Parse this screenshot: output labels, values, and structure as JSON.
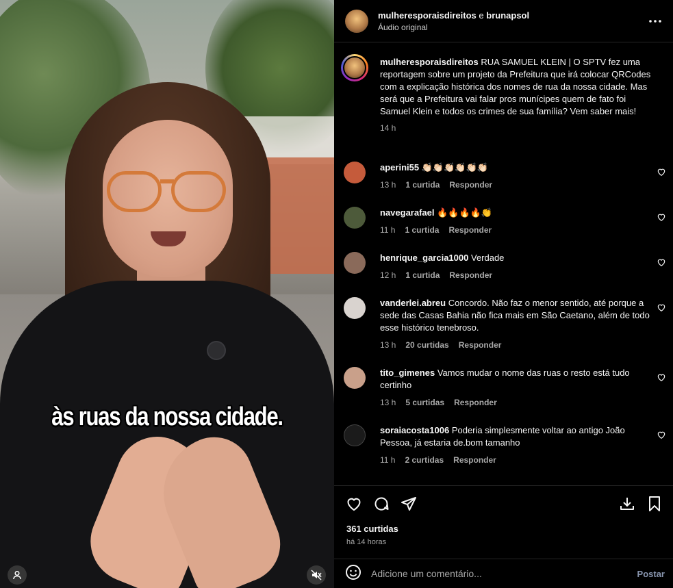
{
  "video": {
    "subtitle": "às ruas da nossa cidade."
  },
  "header": {
    "author1": "mulheresporaisdireitos",
    "conjunction": "e",
    "author2": "brunapsol",
    "audio": "Áudio original"
  },
  "post_caption": {
    "username": "mulheresporaisdireitos",
    "text": "RUA SAMUEL KLEIN | O SPTV fez uma reportagem sobre um projeto da Prefeitura que irá colocar QRCodes com a explicação histórica dos nomes de rua da nossa cidade. Mas será que a Prefeitura vai falar pros munícipes quem de fato foi Samuel Klein e todos os crimes de sua família? Vem saber mais!",
    "time": "14 h"
  },
  "comments": [
    {
      "username": "aperini55",
      "text": "👏🏻👏🏻👏🏻👏🏻👏🏻👏🏻",
      "time": "13 h",
      "likes": "1 curtida",
      "reply": "Responder",
      "avatar_color": "#c55b3b"
    },
    {
      "username": "navegarafael",
      "text": "🔥🔥🔥🔥👏",
      "time": "11 h",
      "likes": "1 curtida",
      "reply": "Responder",
      "avatar_color": "#4d5a3a"
    },
    {
      "username": "henrique_garcia1000",
      "text": "Verdade",
      "time": "12 h",
      "likes": "1 curtida",
      "reply": "Responder",
      "avatar_color": "#8a6a5a"
    },
    {
      "username": "vanderlei.abreu",
      "text": "Concordo. Não faz o menor sentido, até porque a sede das Casas Bahia não fica mais em São Caetano, além de todo esse histórico tenebroso.",
      "time": "13 h",
      "likes": "20 curtidas",
      "reply": "Responder",
      "avatar_color": "#d9d3cf"
    },
    {
      "username": "tito_gimenes",
      "text": "Vamos mudar o nome das ruas o resto está tudo certinho",
      "time": "13 h",
      "likes": "5 curtidas",
      "reply": "Responder",
      "avatar_color": "#c9a08a"
    },
    {
      "username": "soraiacosta1006",
      "text": "Poderia simplesmente voltar ao antigo João Pessoa, já estaria de.bom tamanho",
      "time": "11 h",
      "likes": "2 curtidas",
      "reply": "Responder",
      "avatar_color": "#1b1b1b"
    }
  ],
  "stats": {
    "likes": "361 curtidas",
    "time_ago": "há 14 horas"
  },
  "composer": {
    "placeholder": "Adicione um comentário...",
    "post_label": "Postar"
  },
  "icons": {
    "like": "heart-icon",
    "comment": "comment-icon",
    "share": "share-icon",
    "download": "download-icon",
    "save": "bookmark-icon",
    "more": "more-icon",
    "emoji": "emoji-icon",
    "mute": "mute-icon",
    "tag": "user-tag-icon"
  }
}
